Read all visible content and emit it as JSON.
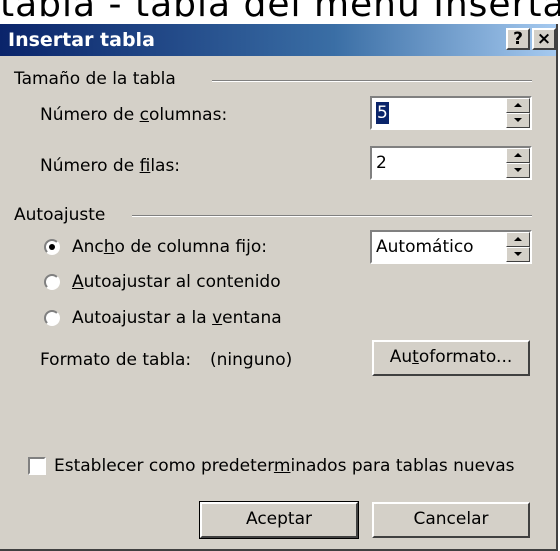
{
  "caption": "tabla - tabla del menú Insertar.",
  "dialog": {
    "title": "Insertar tabla",
    "help_glyph": "?",
    "close_glyph": "×",
    "size_group": {
      "label": "Tamaño de la tabla",
      "columns_label_pre": "Número de ",
      "columns_label_accel": "c",
      "columns_label_post": "olumnas:",
      "columns_value": "5",
      "rows_label_pre": "Número de ",
      "rows_label_accel": "f",
      "rows_label_post": "ilas:",
      "rows_value": "2"
    },
    "autofit_group": {
      "label": "Autoajuste",
      "fixed_pre": "Anc",
      "fixed_accel": "h",
      "fixed_post": "o de columna fijo:",
      "fixed_value": "Automático",
      "content_accel": "A",
      "content_post": "utoajustar al contenido",
      "window_pre": "Autoajustar a la ",
      "window_accel": "v",
      "window_post": "entana",
      "selected_option": "fixed"
    },
    "format": {
      "label": "Formato de tabla:",
      "value": "(ninguno)",
      "button_pre": "Au",
      "button_accel": "t",
      "button_post": "oformato..."
    },
    "default_checkbox": {
      "pre": "Establecer como predeter",
      "accel": "m",
      "post": "inados para tablas nuevas",
      "checked": false
    },
    "ok_label": "Aceptar",
    "cancel_label": "Cancelar"
  }
}
